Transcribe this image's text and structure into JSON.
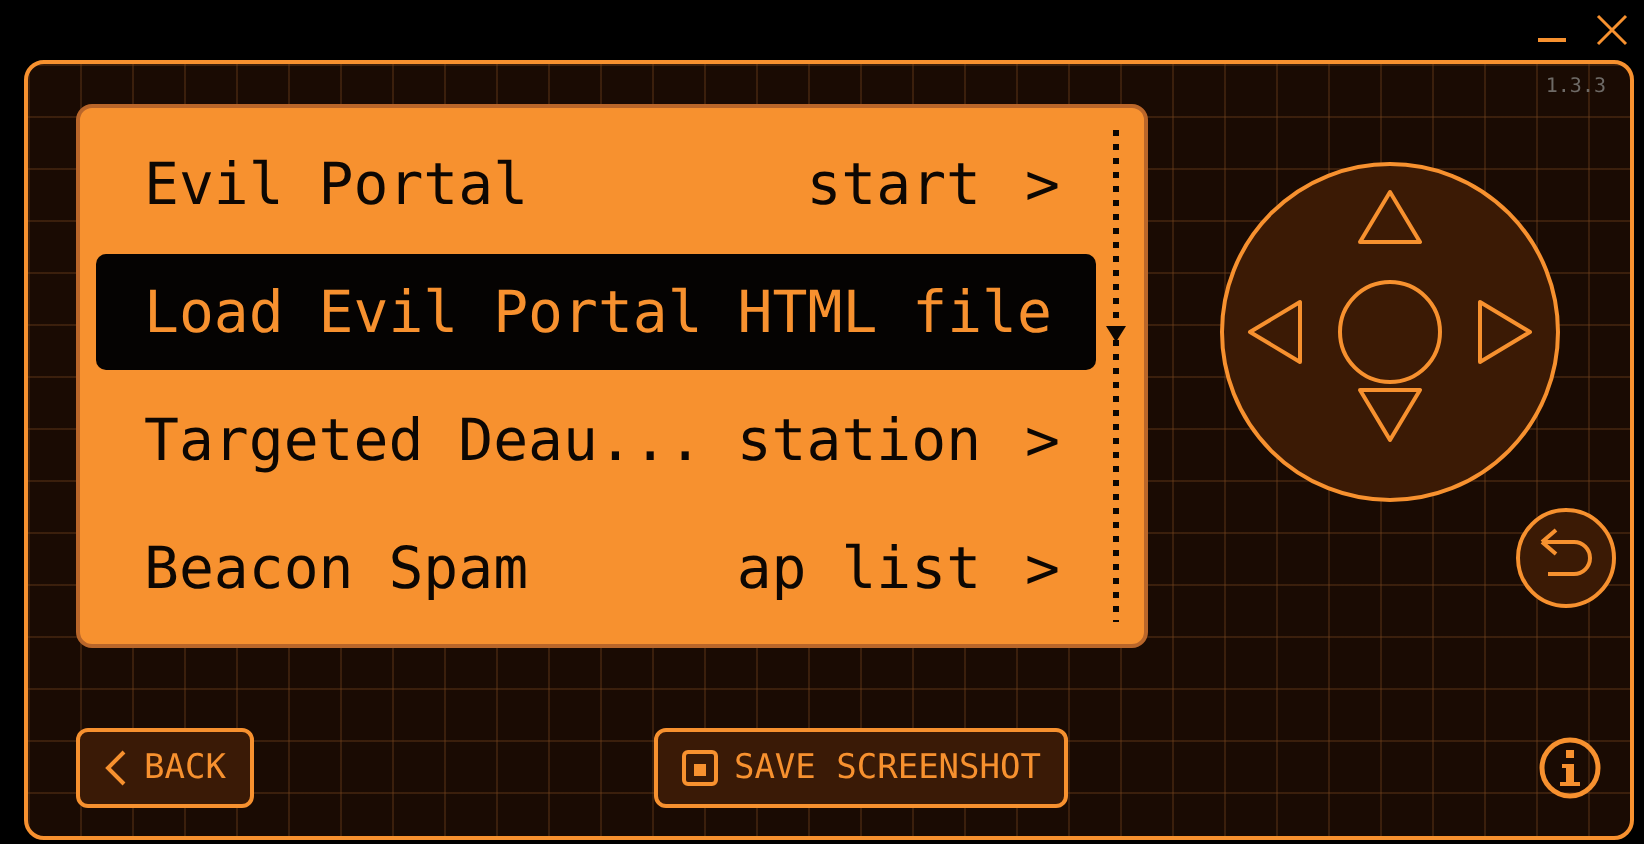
{
  "version": "1.3.3",
  "menu": {
    "items": [
      {
        "label": "Evil Portal",
        "value": "start",
        "chevron": ">",
        "selected": false
      },
      {
        "label": "Load Evil Portal HTML file",
        "selected": true
      },
      {
        "label": "Targeted Deau...",
        "value": "station",
        "chevron": ">",
        "selected": false
      },
      {
        "label": "Beacon Spam",
        "value": "ap list",
        "chevron": ">",
        "selected": false
      }
    ]
  },
  "buttons": {
    "back": "BACK",
    "save": "SAVE SCREENSHOT"
  }
}
